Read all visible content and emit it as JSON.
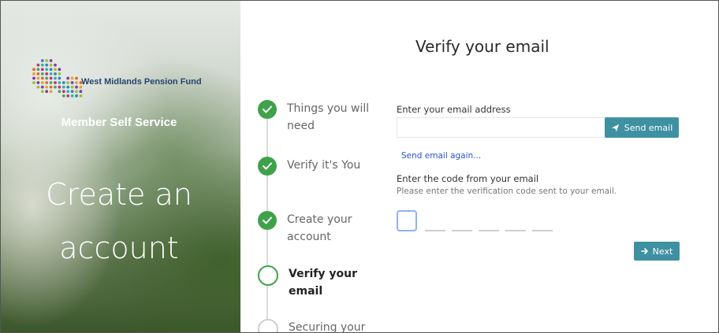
{
  "hero": {
    "brand_name": "West Midlands Pension Fund",
    "subtitle": "Member Self Service",
    "headline_line1": "Create an",
    "headline_line2": "account"
  },
  "page": {
    "title": "Verify your email"
  },
  "steps": [
    {
      "label": "Things you will need",
      "state": "done"
    },
    {
      "label": "Verify it's You",
      "state": "done"
    },
    {
      "label": "Create your account",
      "state": "done"
    },
    {
      "label": "Verify your email",
      "state": "current"
    },
    {
      "label": "Securing your",
      "state": "pending"
    }
  ],
  "form": {
    "email_label": "Enter your email address",
    "email_value": "",
    "send_label": "Send email",
    "resend_link": "Send email again...",
    "code_label": "Enter the code from your email",
    "code_hint": "Please enter the verification code sent to your email.",
    "code_digits": 6,
    "next_label": "Next"
  },
  "colors": {
    "accent": "#3f91a2",
    "success": "#3fa24a",
    "link": "#2b52d1"
  },
  "icons": {
    "send": "paper-plane-icon",
    "next": "arrow-right-icon",
    "check": "check-icon"
  }
}
